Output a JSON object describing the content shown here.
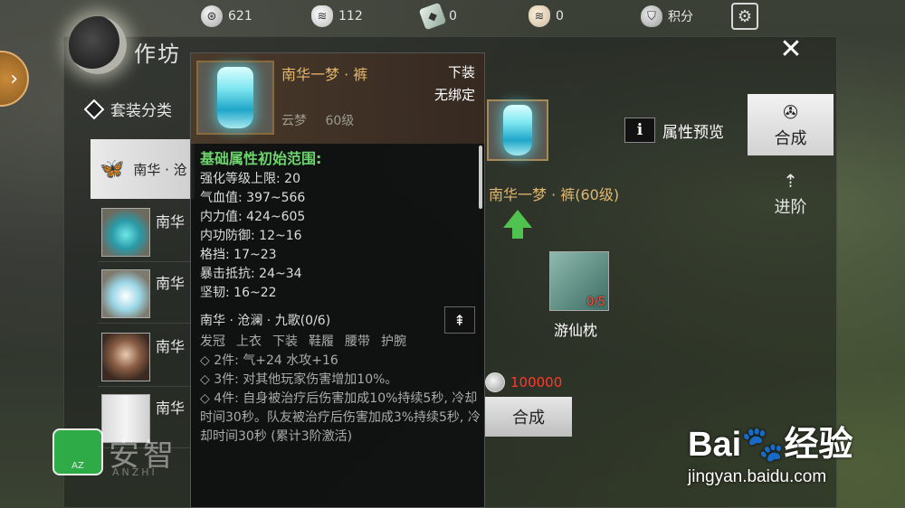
{
  "top_bar": {
    "resources": [
      {
        "icon": "coin-icon",
        "value": "621"
      },
      {
        "icon": "pouch-icon",
        "value": "112"
      },
      {
        "icon": "gem-icon",
        "value": "0"
      },
      {
        "icon": "gold-pouch-icon",
        "value": "0"
      },
      {
        "icon": "shield-icon",
        "value": "积分"
      }
    ]
  },
  "panel": {
    "title": "作坊",
    "suit_category_label": "套装分类",
    "selected_suit": "南华 · 沧",
    "list_items": [
      {
        "label": "南华"
      },
      {
        "label": "南华"
      },
      {
        "label": "南华"
      },
      {
        "label": "南华"
      }
    ]
  },
  "tooltip": {
    "item_name": "南华一梦 · 裤",
    "slot": "下装",
    "bind": "无绑定",
    "source": "云梦",
    "level": "60级",
    "base_header": "基础属性初始范围:",
    "stats": [
      "强化等级上限: 20",
      "气血值: 397~566",
      "内力值: 424~605",
      "内功防御: 12~16",
      "格挡: 17~23",
      "暴击抵抗: 24~34",
      "坚韧: 16~22"
    ],
    "set_title": "南华 · 沧澜 · 九歌(0/6)",
    "set_slots": [
      "发冠",
      "上衣",
      "下装",
      "鞋履",
      "腰带",
      "护腕"
    ],
    "bonuses": [
      "◇ 2件: 气+24 水攻+16",
      "◇ 3件: 对其他玩家伤害增加10%。",
      "◇ 4件: 自身被治疗后伤害加成10%持续5秒, 冷却时间30秒。队友被治疗后伤害加成3%持续5秒, 冷却时间30秒 (累计3阶激活)"
    ]
  },
  "craft": {
    "target_name": "南华一梦 · 裤(60级)",
    "material_name": "游仙枕",
    "material_count": "0/5",
    "cost": "100000",
    "craft_button": "合成",
    "preview_label": "属性预览",
    "info_icon_text": "i"
  },
  "side_tabs": [
    {
      "label": "合成",
      "active": true
    },
    {
      "label": "进阶",
      "active": false
    }
  ],
  "watermarks": {
    "anzhi": "安智",
    "anzhi_sub": "ANZHI",
    "anzhi_badge": "AZ",
    "baidu_logo": "Bai🐾经验",
    "baidu_url": "jingyan.baidu.com"
  },
  "colors": {
    "accent_gold": "#e2b76d",
    "stat_green": "#6ed46e",
    "cost_red": "#ff3a2a"
  }
}
